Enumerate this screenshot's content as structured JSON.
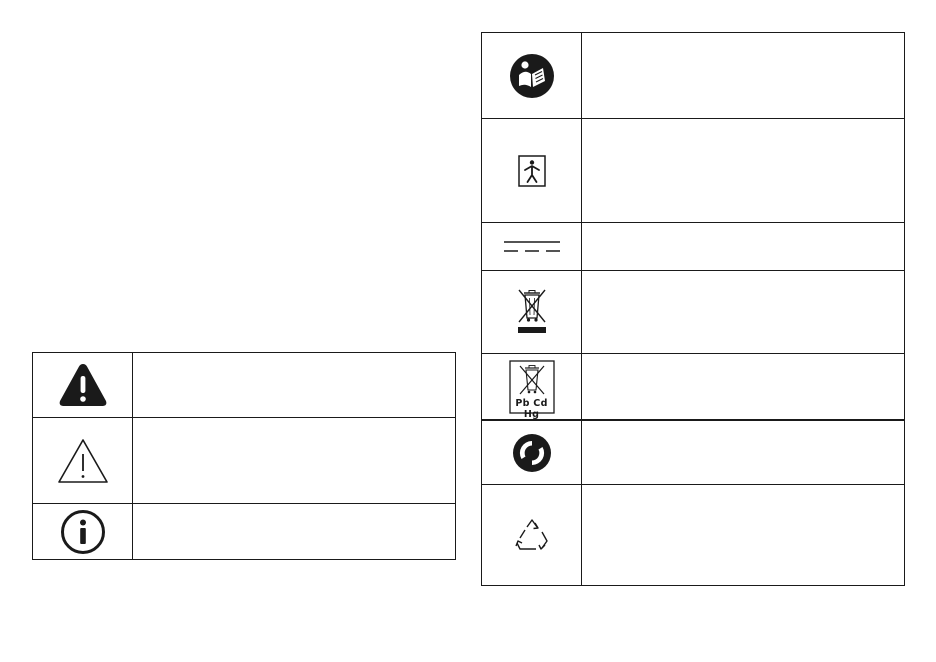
{
  "tables": [
    {
      "rows": [
        {
          "icon": "warning-filled-icon",
          "text": ""
        },
        {
          "icon": "warning-outline-icon",
          "text": ""
        },
        {
          "icon": "information-icon",
          "text": ""
        }
      ]
    },
    {
      "rows": [
        {
          "icon": "read-manual-icon",
          "text": ""
        },
        {
          "icon": "type-bf-applied-part-icon",
          "text": ""
        },
        {
          "icon": "direct-current-icon",
          "text": ""
        },
        {
          "icon": "weee-crossed-bin-icon",
          "text": ""
        },
        {
          "icon": "battery-disposal-icon",
          "text": "",
          "icon_label": "Pb Cd Hg"
        },
        {
          "icon": "green-dot-icon",
          "text": ""
        },
        {
          "icon": "recycling-icon",
          "text": ""
        }
      ]
    }
  ]
}
